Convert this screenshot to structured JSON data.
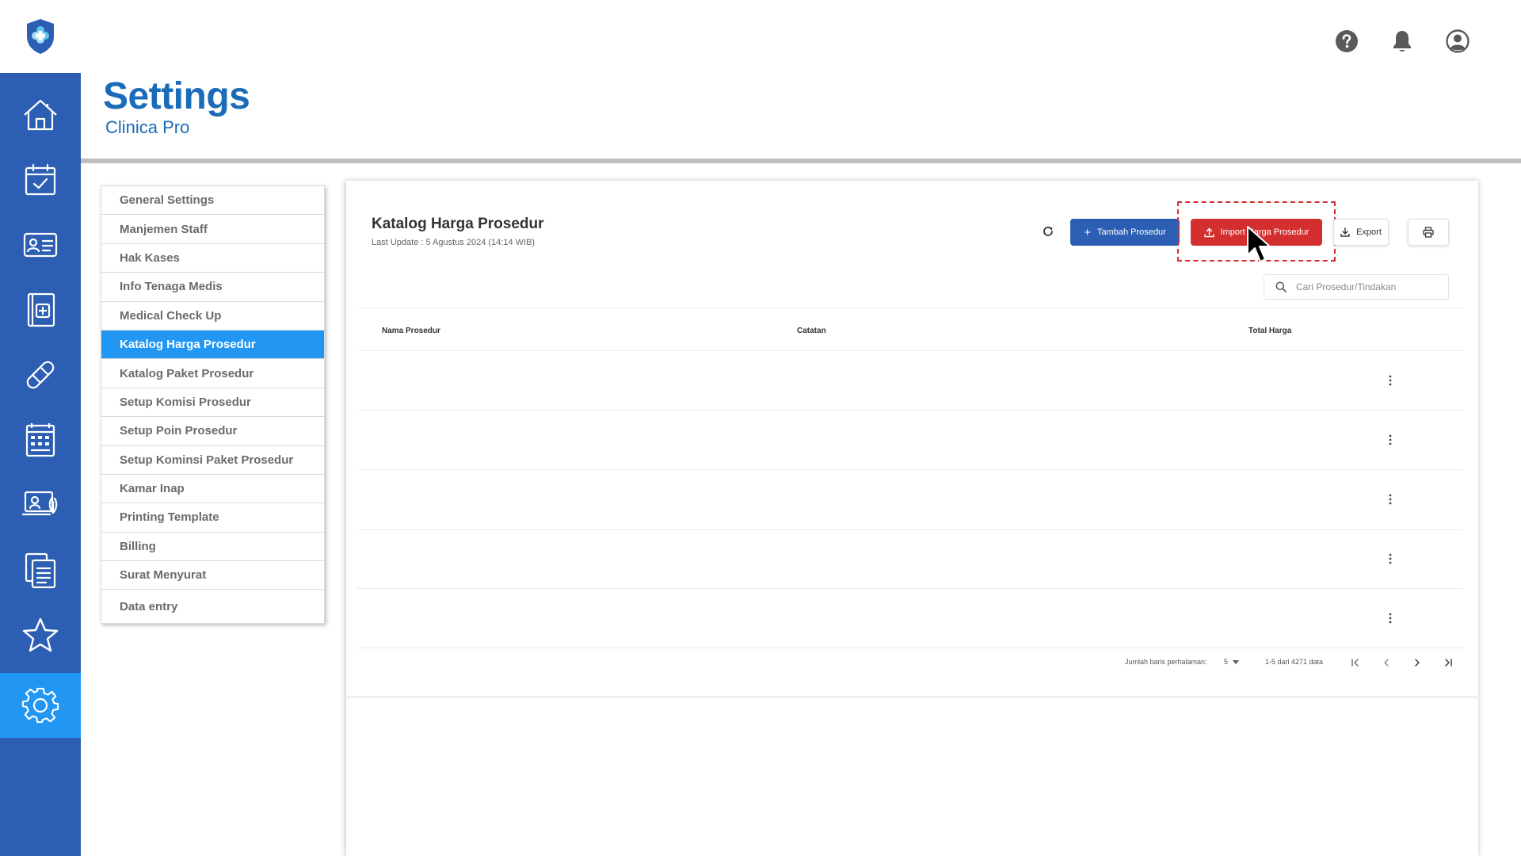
{
  "app": {
    "title": "Settings",
    "subtitle": "Clinica Pro"
  },
  "sidebar": {
    "items": [
      {
        "name": "home-icon"
      },
      {
        "name": "calendar-check-icon"
      },
      {
        "name": "patient-card-icon"
      },
      {
        "name": "medical-record-icon"
      },
      {
        "name": "bandage-icon"
      },
      {
        "name": "schedule-calendar-icon"
      },
      {
        "name": "telemedicine-icon"
      },
      {
        "name": "clipboard-documents-icon"
      },
      {
        "name": "star-icon"
      },
      {
        "name": "gear-icon",
        "active": true
      }
    ]
  },
  "settings_menu": {
    "items": [
      {
        "label": "General Settings"
      },
      {
        "label": "Manjemen Staff"
      },
      {
        "label": "Hak Kases"
      },
      {
        "label": "Info Tenaga Medis"
      },
      {
        "label": "Medical Check Up"
      },
      {
        "label": "Katalog Harga Prosedur",
        "active": true
      },
      {
        "label": "Katalog Paket Prosedur"
      },
      {
        "label": "Setup Komisi Prosedur"
      },
      {
        "label": "Setup Poin Prosedur"
      },
      {
        "label": "Setup Kominsi Paket Prosedur"
      },
      {
        "label": "Kamar Inap"
      },
      {
        "label": "Printing Template"
      },
      {
        "label": "Billing"
      },
      {
        "label": "Surat Menyurat"
      },
      {
        "label": "Data entry"
      }
    ]
  },
  "card": {
    "title": "Katalog Harga Prosedur",
    "last_update": "Last Update : 5 Agustus 2024 (14:14 WIB)",
    "buttons": {
      "add": "Tambah Prosedur",
      "import": "Import Harga Prosedur",
      "export": "Export"
    },
    "search": {
      "placeholder": "Cari Prosedur/Tindakan"
    },
    "table": {
      "headers": [
        "Nama Prosedur",
        "Catatan",
        "Total Harga"
      ],
      "row_count": 5
    },
    "pagination": {
      "rows_label": "Jumlah baris perhalaman:",
      "rows_value": "5",
      "range": "1-5 dari 4271 data"
    }
  },
  "colors": {
    "sidebar": "#2c5fb3",
    "active": "#2196f3",
    "primary": "#2c5fb3",
    "danger": "#d32f2f",
    "title": "#1a6bb8"
  }
}
